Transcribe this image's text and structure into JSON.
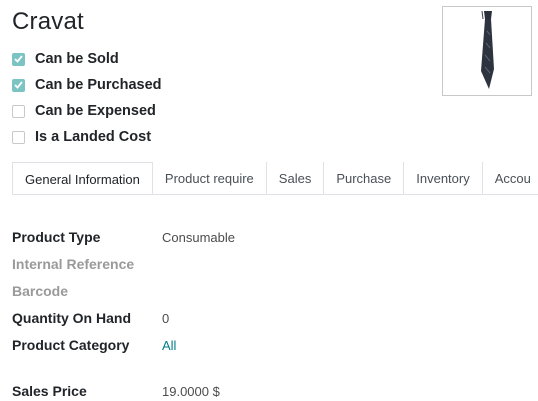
{
  "product": {
    "name": "Cravat",
    "image_icon": "necktie-image"
  },
  "options": [
    {
      "label": "Can be Sold",
      "checked": true
    },
    {
      "label": "Can be Purchased",
      "checked": true
    },
    {
      "label": "Can be Expensed",
      "checked": false
    },
    {
      "label": "Is a Landed Cost",
      "checked": false
    }
  ],
  "tabs": [
    {
      "label": "General Information",
      "active": true
    },
    {
      "label": "Product require",
      "active": false
    },
    {
      "label": "Sales",
      "active": false
    },
    {
      "label": "Purchase",
      "active": false
    },
    {
      "label": "Inventory",
      "active": false
    },
    {
      "label": "Accou",
      "active": false
    }
  ],
  "fields": {
    "product_type": {
      "label": "Product Type",
      "value": "Consumable"
    },
    "internal_reference": {
      "label": "Internal Reference",
      "value": ""
    },
    "barcode": {
      "label": "Barcode",
      "value": ""
    },
    "quantity_on_hand": {
      "label": "Quantity On Hand",
      "value": "0"
    },
    "product_category": {
      "label": "Product Category",
      "value": "All"
    },
    "sales_price": {
      "label": "Sales Price",
      "value": "19.0000 $"
    }
  },
  "colors": {
    "checkbox_checked": "#7cc4c4",
    "link": "#017e84",
    "muted_label": "#9a9a9a"
  }
}
